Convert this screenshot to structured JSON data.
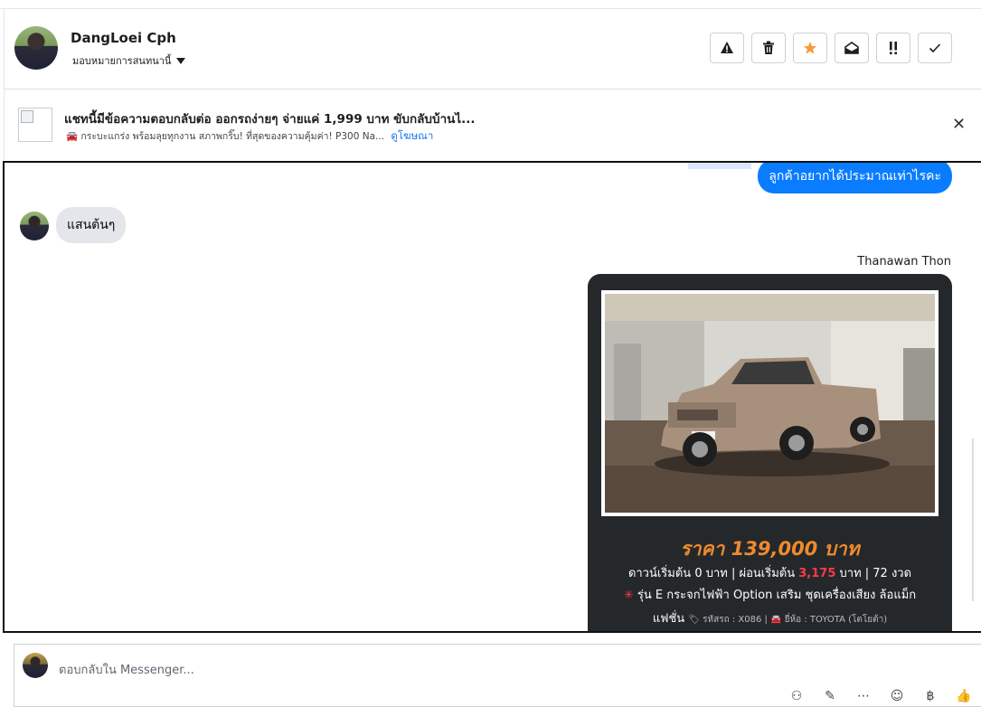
{
  "header": {
    "contact_name": "DangLoei Cph",
    "assign_label": "มอบหมายการสนทนานี้",
    "actions": [
      {
        "name": "report-icon",
        "glyph": "⚠"
      },
      {
        "name": "trash-icon",
        "glyph": "🗑"
      },
      {
        "name": "star-icon",
        "glyph": "★",
        "color": "#f29b39"
      },
      {
        "name": "mark-unread-icon",
        "glyph": "✉"
      },
      {
        "name": "follow-up-icon",
        "glyph": "!!"
      },
      {
        "name": "done-check-icon",
        "glyph": "✓"
      }
    ]
  },
  "ad_banner": {
    "title": "แชทนี้มีข้อความตอบกลับต่อ ออกรถง่ายๆ จ่ายแค่ 1,999 บาท ขับกลับบ้านไ...",
    "subtitle": "🚘 กระบะแกร่ง พร้อมลุยทุกงาน สภาพกริ๊บ! ที่สุดของความคุ้มค่า! P300 Na...",
    "link_label": "ดูโฆษณา"
  },
  "messages": {
    "outgoing_text": "ลูกค้าอยากได้ประมาณเท่าไรคะ",
    "incoming_text": "แสนต้นๆ",
    "sender_name": "Thanawan Thon",
    "card": {
      "price": "ราคา 139,000 บาท",
      "down_payment_a": "ดาวน์เริ่มต้น 0 บาท | ผ่อนเริ่มต้น ",
      "installment_value": "3,175",
      "down_payment_b": " บาท | 72 งวด",
      "spec_star": "✳",
      "spec_line": "รุ่น E กระจกไฟฟ้า Option เสริม ชุดเครื่องเสียง ล้อแม็ก",
      "spec_line2": "แฟชั่น",
      "meta": "🏷 รหัสรถ : X086 | 🚘 ยี่ห้อ : TOYOTA (โตโยต้า)"
    }
  },
  "composer": {
    "placeholder": "ตอบกลับใน Messenger...",
    "tools": [
      {
        "name": "add-contact-icon",
        "glyph": "⚇"
      },
      {
        "name": "attachment-icon",
        "glyph": "✎"
      },
      {
        "name": "more-icon",
        "glyph": "⋯"
      },
      {
        "name": "emoji-icon",
        "glyph": "☺"
      },
      {
        "name": "payment-icon",
        "glyph": "฿"
      },
      {
        "name": "thumbs-up-icon",
        "glyph": "👍"
      }
    ]
  }
}
